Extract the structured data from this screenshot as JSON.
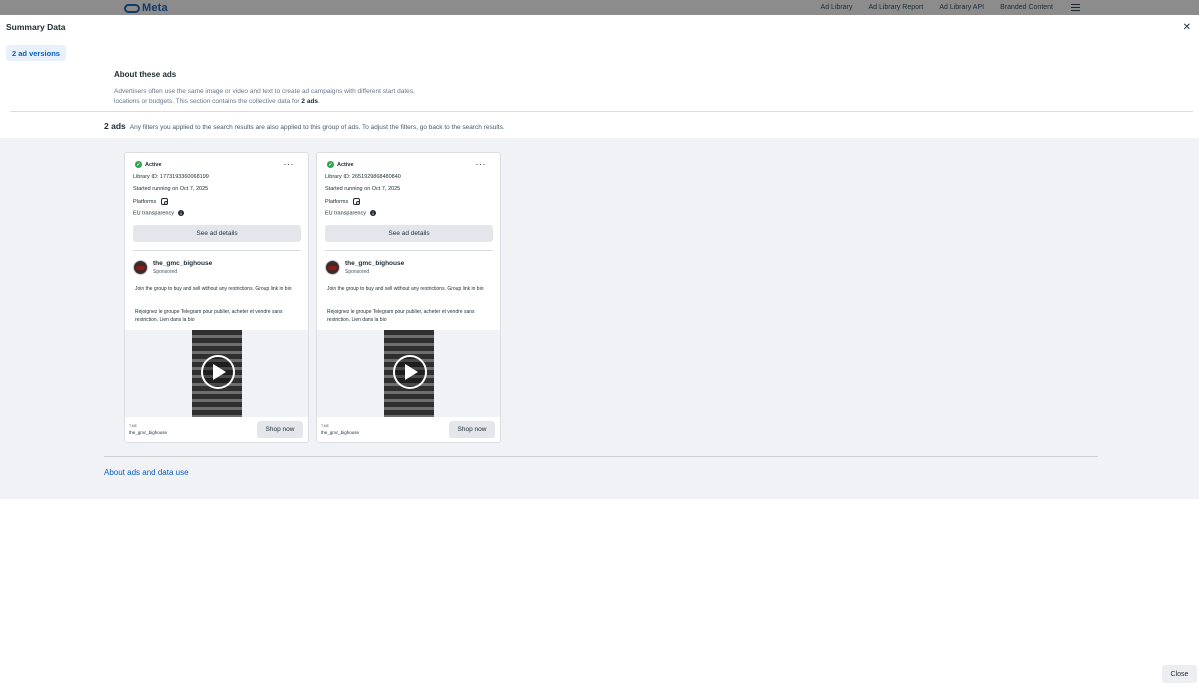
{
  "nav": {
    "brand": "Meta",
    "links": [
      "Ad Library",
      "Ad Library Report",
      "Ad Library API",
      "Branded Content"
    ]
  },
  "modal": {
    "title": "Summary Data",
    "versions_label": "2 ad versions",
    "about": {
      "heading": "About these ads",
      "body_prefix": "Advertisers often use the same image or video and text to create ad campaigns with different start dates, locations or budgets. This section contains the collective data for ",
      "body_count": "2 ads",
      "body_suffix": "."
    },
    "summary": {
      "count": "2 ads",
      "text": "Any filters you applied to the search results are also applied to this group of ads. To adjust the filters, go back to the search results."
    },
    "cards": [
      {
        "status": "Active",
        "library_id": "Library ID: 1773193360068199",
        "started": "Started running on Oct 7, 2025",
        "platforms_label": "Platforms",
        "eu_label": "EU transparency",
        "details_label": "See ad details",
        "page_name": "the_gmc_bighouse",
        "sponsored": "Sponsored",
        "text_en": "Join the group to buy and sell without any restrictions. Group link in bio",
        "text_fr": "Rejoignez le groupe Telegram pour publier, acheter et vendre sans restriction. Lien dans la bio",
        "cta_url": "T.ME",
        "cta_name": "the_gmc_bighouse",
        "cta_button": "Shop now"
      },
      {
        "status": "Active",
        "library_id": "Library ID: 2651929868480840",
        "started": "Started running on Oct 7, 2025",
        "platforms_label": "Platforms",
        "eu_label": "EU transparency",
        "details_label": "See ad details",
        "page_name": "the_gmc_bighouse",
        "sponsored": "Sponsored",
        "text_en": "Join the group to buy and sell without any restrictions. Group link in bio",
        "text_fr": "Rejoignez le groupe Telegram pour publier, acheter et vendre sans restriction. Lien dans la bio",
        "cta_url": "T.ME",
        "cta_name": "the_gmc_bighouse",
        "cta_button": "Shop now"
      }
    ],
    "about_link": "About ads and data use",
    "close_button": "Close"
  },
  "colors": {
    "link": "#0a5fc1",
    "active_green": "#31a24c",
    "overlay": "#8f8f8f"
  }
}
